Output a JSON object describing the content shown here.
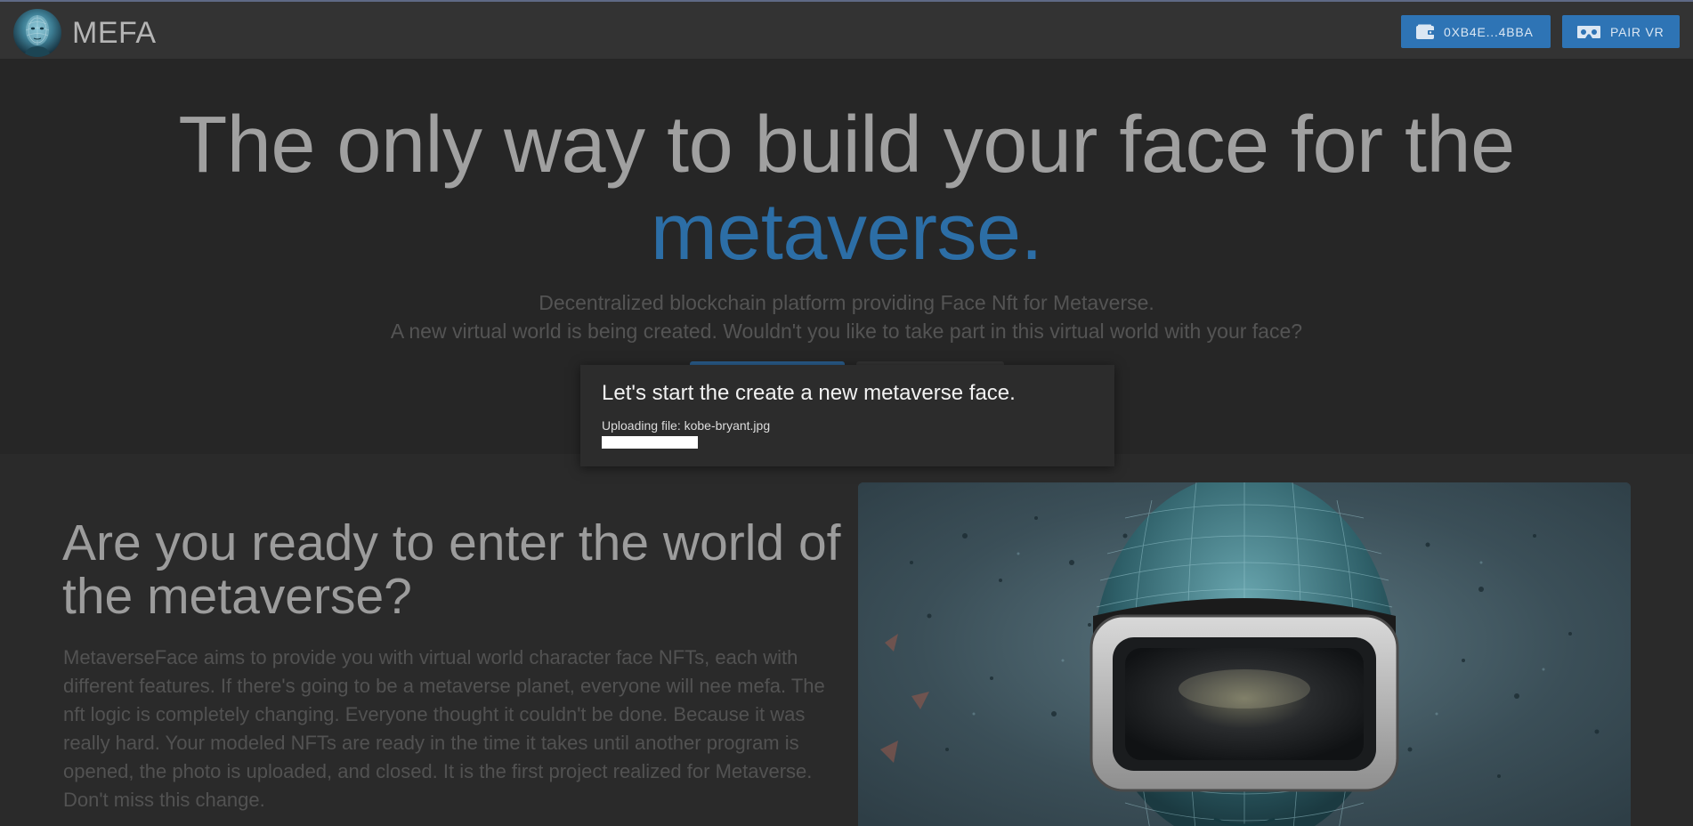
{
  "header": {
    "brand": "MEFA",
    "wallet_label": "0XB4E...4BBA",
    "vr_label": "PAIR VR",
    "icons": [
      "avatar-logo",
      "wallet-icon",
      "vr-headset-icon"
    ]
  },
  "hero": {
    "title_line1": "The only way to build your face for the",
    "title_accent": "metaverse.",
    "subtitle_line1": "Decentralized blockchain platform providing Face Nft for Metaverse.",
    "subtitle_line2": "A new virtual world is being created. Wouldn't you like to take part in this virtual world with your face?"
  },
  "about": {
    "title": "Are you ready to enter the world of the metaverse?",
    "body": "MetaverseFace aims to provide you with virtual world character face NFTs, each with different features. If there's going to be a metaverse planet, everyone will nee mefa. The nft logic is completely changing. Everyone thought it couldn't be done. Because it was really hard. Your modeled NFTs are ready in the time it takes until another program is opened, the photo is uploaded, and closed. It is the first project realized for Metaverse. Don't miss this change."
  },
  "modal": {
    "title": "Let's start the create a new metaverse face.",
    "status": "Uploading file: kobe-bryant.jpg",
    "progress": 0.2
  },
  "colors": {
    "accent": "#2e74b5",
    "accent_text": "#2c6ea6",
    "background": "#262626",
    "topbar": "#333333"
  }
}
